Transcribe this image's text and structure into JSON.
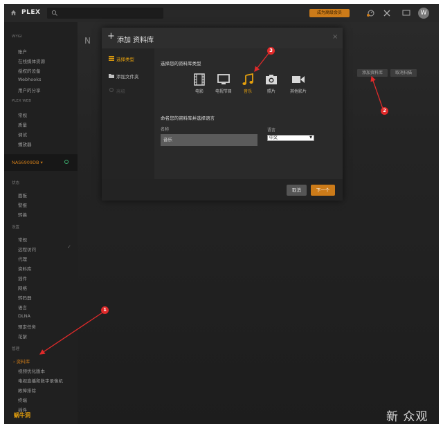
{
  "topbar": {
    "logo": "PLEX",
    "premium_label": "成为高级会员",
    "avatar_letter": "W",
    "icons": [
      "home-icon",
      "search-icon",
      "activity-icon",
      "settings-icon",
      "avatar"
    ]
  },
  "sidebar": {
    "sections": [
      {
        "title": "WYGI",
        "items": [
          "账户",
          "在线媒体资源",
          "授权的设备",
          "Webhooks",
          "用户的分享"
        ]
      },
      {
        "title": "PLEX WEB",
        "items": [
          "常规",
          "质量",
          "调试",
          "播放器"
        ]
      }
    ],
    "server": {
      "name": "NAS6909DB ▾"
    },
    "server_sections": [
      {
        "title": "状态",
        "items": [
          "面板",
          "警报",
          "转换"
        ]
      },
      {
        "title": "设置",
        "items": [
          "常规",
          "远程访问",
          "代理",
          "资料库",
          "插件",
          "网络",
          "转码器",
          "语言",
          "DLNA",
          "预定任务",
          "花絮"
        ]
      },
      {
        "title": "管理",
        "items": [
          "› 资料库",
          "视频优化版本",
          "电视直播和数字录像机",
          "故障排除",
          "终端",
          "插件"
        ]
      }
    ]
  },
  "main": {
    "hint": "N",
    "add_library_button": "添加资料库",
    "cancel_scan_button": "取消扫描"
  },
  "modal": {
    "title": "添加 资料库",
    "close": "×",
    "nav": [
      {
        "label": "选择类型",
        "icon": "stack-icon",
        "active": true
      },
      {
        "label": "添加文件夹",
        "icon": "folder-icon",
        "active": false
      },
      {
        "label": "高级",
        "icon": "gear-icon",
        "active": false
      }
    ],
    "type_section_title": "选择您的资料库类型",
    "types": [
      {
        "label": "电影",
        "icon": "film-icon",
        "active": false
      },
      {
        "label": "电视节目",
        "icon": "tv-icon",
        "active": false
      },
      {
        "label": "音乐",
        "icon": "music-icon",
        "active": true
      },
      {
        "label": "照片",
        "icon": "camera-icon",
        "active": false
      },
      {
        "label": "其他影片",
        "icon": "video-camera-icon",
        "active": false
      }
    ],
    "name_section_title": "命名您的资料库并选择语言",
    "name_label": "名称",
    "name_value": "音乐",
    "language_label": "语言",
    "language_value": "中文",
    "cancel_button": "取消",
    "next_button": "下一个"
  },
  "annotations": [
    "1",
    "2",
    "3"
  ],
  "watermarks": {
    "left": "蜗牛洞",
    "right": "新 众观"
  },
  "colors": {
    "accent": "#cc7b19",
    "active_icon": "#e5a00d",
    "annotation": "#e02a2a",
    "background": "#1b1b1b"
  }
}
